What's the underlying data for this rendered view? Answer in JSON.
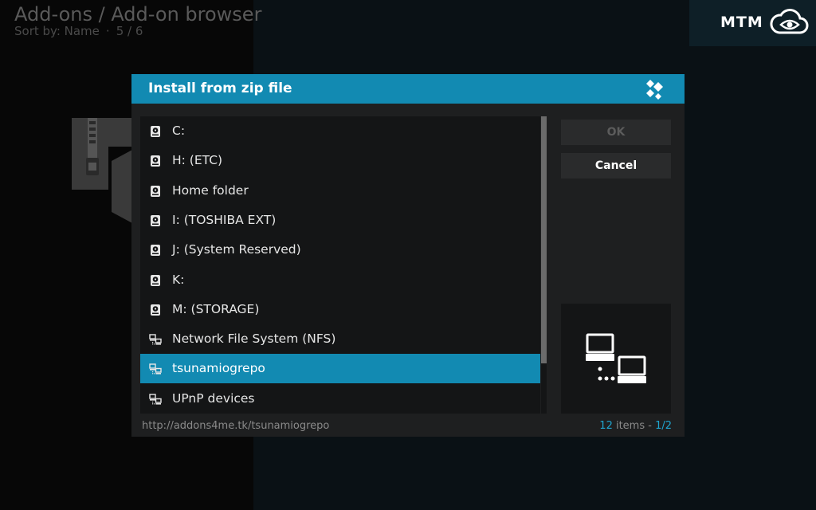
{
  "header": {
    "title": "Add-ons / Add-on browser",
    "sort_label": "Sort by: Name",
    "dot": "·",
    "position": "5 / 6"
  },
  "brand": {
    "text": "MTM"
  },
  "dialog": {
    "title": "Install from zip file",
    "items": [
      {
        "label": "C:",
        "icon": "hdd-icon"
      },
      {
        "label": "H: (ETC)",
        "icon": "hdd-icon"
      },
      {
        "label": "Home folder",
        "icon": "hdd-icon"
      },
      {
        "label": "I: (TOSHIBA EXT)",
        "icon": "hdd-icon"
      },
      {
        "label": "J: (System Reserved)",
        "icon": "hdd-icon"
      },
      {
        "label": "K:",
        "icon": "hdd-icon"
      },
      {
        "label": "M: (STORAGE)",
        "icon": "hdd-icon"
      },
      {
        "label": "Network File System (NFS)",
        "icon": "network-icon"
      },
      {
        "label": "tsunamiogrepo",
        "icon": "network-icon",
        "selected": true
      },
      {
        "label": "UPnP devices",
        "icon": "network-icon"
      }
    ],
    "ok_label": "OK",
    "cancel_label": "Cancel",
    "footer_path": "http://addons4me.tk/tsunamiogrepo",
    "count": "12",
    "count_suffix": " items - ",
    "page": "1/2"
  },
  "colors": {
    "accent": "#128ab2",
    "dialog_bg": "#1e1f20",
    "list_bg": "#141516"
  }
}
